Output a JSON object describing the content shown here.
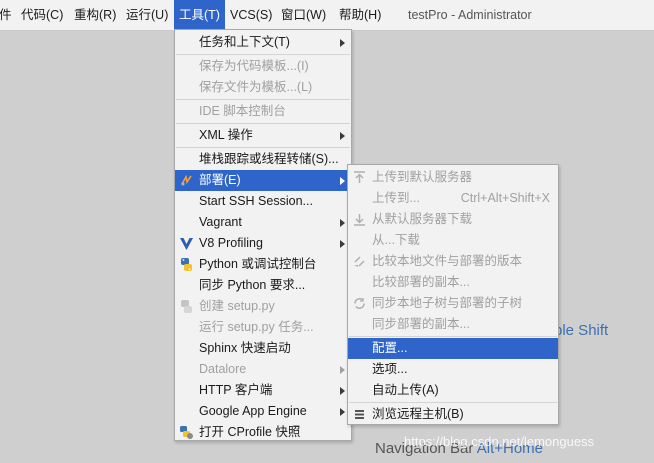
{
  "menubar": {
    "items": [
      "代码(C)",
      "重构(R)",
      "运行(U)",
      "工具(T)",
      "VCS(S)",
      "窗口(W)",
      "帮助(H)"
    ],
    "left_partial": "件",
    "window_title": "testPro - Administrator"
  },
  "tools_menu": {
    "items": [
      {
        "label": "任务和上下文(T)",
        "enabled": true,
        "submenu": true
      },
      {
        "label": "保存为代码模板...(I)",
        "enabled": false
      },
      {
        "label": "保存文件为模板...(L)",
        "enabled": false
      },
      {
        "label": "IDE 脚本控制台",
        "enabled": false
      },
      {
        "label": "XML 操作",
        "enabled": true,
        "submenu": true
      },
      {
        "label": "堆栈跟踪或线程转储(S)...",
        "enabled": true
      },
      {
        "label": "部署(E)",
        "enabled": true,
        "submenu": true,
        "selected": true,
        "icon": "deploy-icon"
      },
      {
        "label": "Start SSH Session...",
        "enabled": true
      },
      {
        "label": "Vagrant",
        "enabled": true,
        "submenu": true
      },
      {
        "label": "V8 Profiling",
        "enabled": true,
        "submenu": true,
        "icon": "v8-icon"
      },
      {
        "label": "Python 或调试控制台",
        "enabled": true,
        "icon": "python-icon"
      },
      {
        "label": "同步 Python 要求...",
        "enabled": true
      },
      {
        "label": "创建 setup.py",
        "enabled": false,
        "icon": "setup-py-icon"
      },
      {
        "label": "运行 setup.py 任务...",
        "enabled": false
      },
      {
        "label": "Sphinx 快速启动",
        "enabled": true
      },
      {
        "label": "Datalore",
        "enabled": false,
        "submenu": true
      },
      {
        "label": "HTTP 客户端",
        "enabled": true,
        "submenu": true
      },
      {
        "label": "Google App Engine",
        "enabled": true,
        "submenu": true
      },
      {
        "label": "打开 CProfile 快照",
        "enabled": true,
        "icon": "cprofile-icon"
      }
    ]
  },
  "deploy_submenu": {
    "items": [
      {
        "label": "上传到默认服务器",
        "enabled": false,
        "icon": "upload-icon"
      },
      {
        "label": "上传到...",
        "enabled": false,
        "shortcut": "Ctrl+Alt+Shift+X"
      },
      {
        "label": "从默认服务器下载",
        "enabled": false,
        "icon": "download-icon"
      },
      {
        "label": "从...下载",
        "enabled": false
      },
      {
        "label": "比较本地文件与部署的版本",
        "enabled": false,
        "icon": "compare-icon"
      },
      {
        "label": "比较部署的副本...",
        "enabled": false
      },
      {
        "label": "同步本地子树与部署的子树",
        "enabled": false,
        "icon": "sync-icon"
      },
      {
        "label": "同步部署的副本...",
        "enabled": false
      },
      {
        "label": "配置...",
        "enabled": true,
        "selected": true
      },
      {
        "label": "选项...",
        "enabled": true
      },
      {
        "label": "自动上传(A)",
        "enabled": true
      },
      {
        "label": "浏览远程主机(B)",
        "enabled": true,
        "icon": "remote-host-icon"
      }
    ]
  },
  "background": {
    "hint_shift": "ble Shift",
    "nav_prefix": "Navigation Bar",
    "nav_shortcut": "Alt+Home",
    "watermark": "https://blog.csdn.net/lemonguess"
  },
  "colors": {
    "selection": "#2f65ca",
    "menu_bg": "#f2f2f2",
    "editor_bg": "#cfcfcf",
    "disabled_text": "#a0a0a0",
    "hint_text": "#3f6fb0"
  }
}
